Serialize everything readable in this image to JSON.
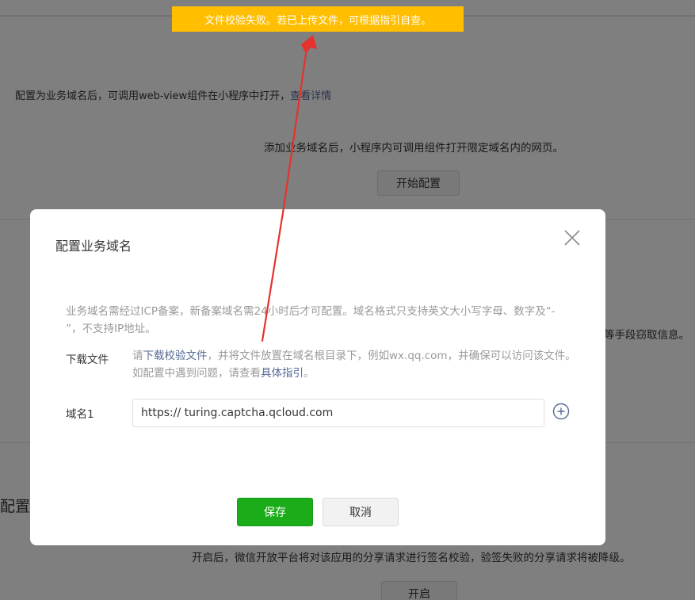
{
  "toast": {
    "message": "文件校验失败。若已上传文件，可根据指引自查。"
  },
  "background": {
    "description_text": "配置为业务域名后，可调用web-view组件在小程序中打开，",
    "description_link": "查看详情",
    "hint": "添加业务域名后，小程序内可调用组件打开限定域名内的网页。",
    "start_button": "开始配置",
    "side_text": "等手段窃取信息。",
    "left_title": "配置",
    "open_hint": "开启后，微信开放平台将对该应用的分享请求进行签名校验，验签失败的分享请求将被降级。",
    "open_button": "开启"
  },
  "dialog": {
    "title": "配置业务域名",
    "notice": "业务域名需经过ICP备案，新备案域名需24小时后才可配置。域名格式只支持英文大小写字母、数字及“- ”，不支持IP地址。",
    "download_label": "下载文件",
    "download_prefix": "请",
    "download_link": "下载校验文件",
    "download_middle": "，并将文件放置在域名根目录下，例如wx.qq.com，并确保可以访问该文件。如配置中遇到问题，请查看",
    "guide_link": "具体指引",
    "download_suffix": "。",
    "domain_label": "域名1",
    "domain_value": "https:// turing.captcha.qcloud.com",
    "save_button": "保存",
    "cancel_button": "取消"
  },
  "colors": {
    "toast_bg": "#ffbe00",
    "primary_green": "#1aad19",
    "link_blue": "#576b95",
    "arrow_red": "#e5322d"
  }
}
